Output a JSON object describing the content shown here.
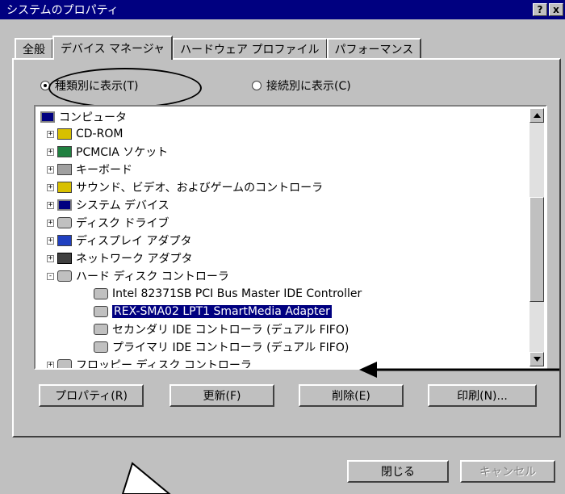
{
  "window": {
    "title": "システムのプロパティ",
    "help_button": "?",
    "close_button": "x"
  },
  "tabs": [
    {
      "label": "全般"
    },
    {
      "label": "デバイス マネージャ"
    },
    {
      "label": "ハードウェア プロファイル"
    },
    {
      "label": "パフォーマンス"
    }
  ],
  "view_options": {
    "by_type": "種類別に表示(T)",
    "by_connection": "接続別に表示(C)"
  },
  "tree": [
    {
      "label": "コンピュータ",
      "icon": "computer-icon"
    },
    {
      "label": "CD-ROM",
      "icon": "cdrom-icon"
    },
    {
      "label": "PCMCIA ソケット",
      "icon": "pcmcia-icon"
    },
    {
      "label": "キーボード",
      "icon": "keyboard-icon"
    },
    {
      "label": "サウンド、ビデオ、およびゲームのコントローラ",
      "icon": "sound-icon"
    },
    {
      "label": "システム デバイス",
      "icon": "system-icon"
    },
    {
      "label": "ディスク ドライブ",
      "icon": "disk-drive-icon"
    },
    {
      "label": "ディスプレイ アダプタ",
      "icon": "display-icon"
    },
    {
      "label": "ネットワーク アダプタ",
      "icon": "network-icon"
    },
    {
      "label": "ハード ディスク コントローラ",
      "icon": "hdd-controller-icon"
    },
    {
      "label": "Intel 82371SB PCI Bus Master IDE Controller",
      "icon": "hdd-controller-icon"
    },
    {
      "label": "REX-SMA02 LPT1 SmartMedia Adapter",
      "icon": "hdd-controller-icon",
      "selected": true
    },
    {
      "label": "セカンダリ IDE コントローラ (デュアル FIFO)",
      "icon": "hdd-controller-icon"
    },
    {
      "label": "プライマリ IDE コントローラ (デュアル FIFO)",
      "icon": "hdd-controller-icon"
    },
    {
      "label": "フロッピー ディスク コントローラ",
      "icon": "floppy-controller-icon"
    }
  ],
  "tree_expander": {
    "plus": "+",
    "minus": "-"
  },
  "buttons": {
    "properties": "プロパティ(R)",
    "refresh": "更新(F)",
    "delete": "削除(E)",
    "print": "印刷(N)...",
    "close": "閉じる",
    "cancel": "キャンセル"
  },
  "colors": {
    "titlebar": "#000080",
    "selection": "#000080",
    "face": "#c0c0c0"
  }
}
